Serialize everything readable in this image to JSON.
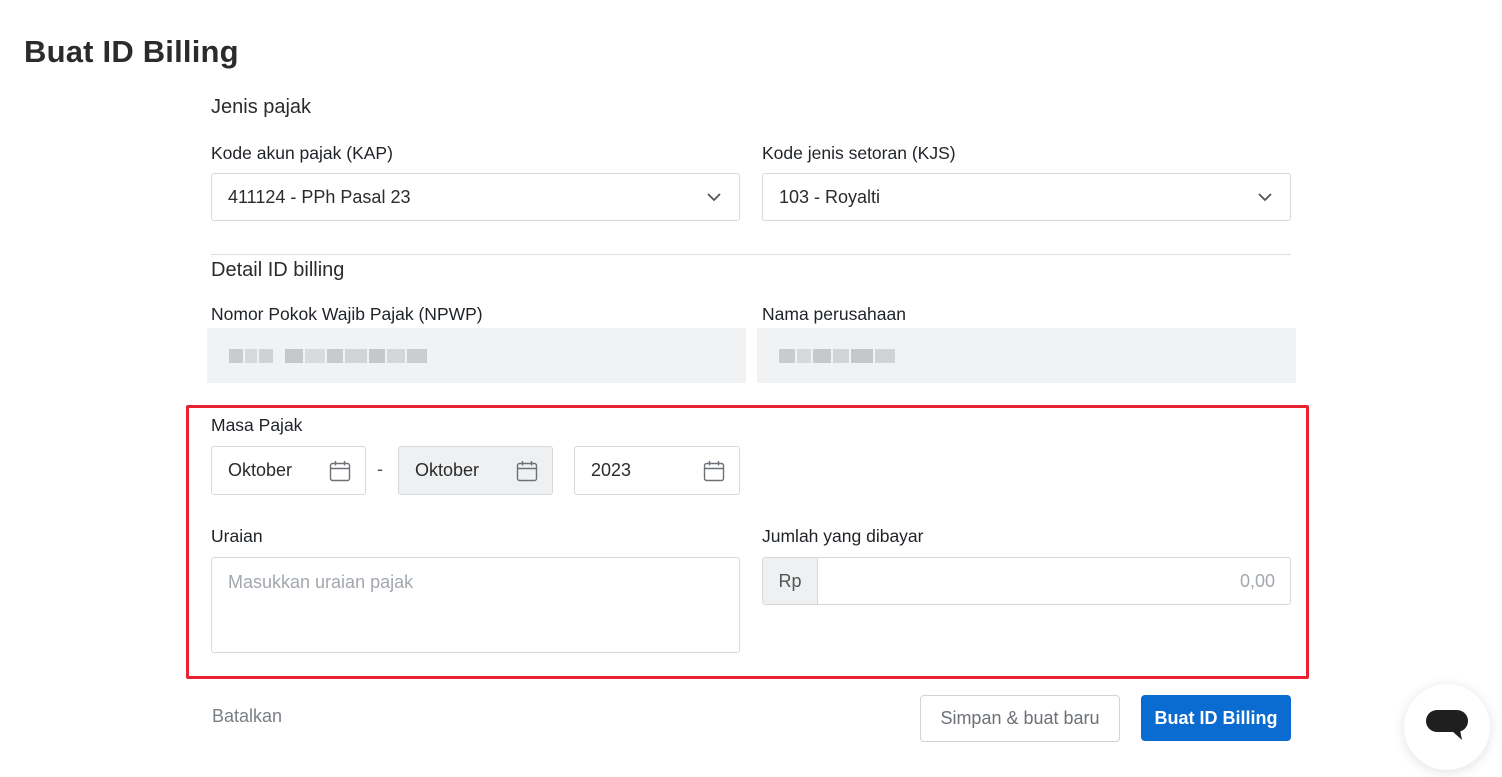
{
  "page": {
    "title": "Buat ID Billing"
  },
  "jenis_pajak": {
    "section_title": "Jenis pajak",
    "kap": {
      "label": "Kode akun pajak (KAP)",
      "value": "411124 - PPh Pasal 23"
    },
    "kjs": {
      "label": "Kode jenis setoran (KJS)",
      "value": "103 - Royalti"
    }
  },
  "detail": {
    "section_title": "Detail ID billing",
    "npwp": {
      "label": "Nomor Pokok Wajib Pajak (NPWP)"
    },
    "nama": {
      "label": "Nama perusahaan"
    }
  },
  "masa_pajak": {
    "label": "Masa Pajak",
    "from_month": "Oktober",
    "separator": "-",
    "to_month": "Oktober",
    "year": "2023"
  },
  "uraian": {
    "label": "Uraian",
    "placeholder": "Masukkan uraian pajak"
  },
  "jumlah": {
    "label": "Jumlah yang dibayar",
    "prefix": "Rp",
    "placeholder": "0,00"
  },
  "actions": {
    "cancel": "Batalkan",
    "save_new": "Simpan & buat baru",
    "submit": "Buat ID Billing"
  },
  "colors": {
    "primary": "#0a6bd1",
    "highlight": "#e8232f"
  },
  "icons": {
    "dropdown": "chevron-down-icon",
    "calendar": "calendar-icon",
    "chat": "chat-icon"
  }
}
